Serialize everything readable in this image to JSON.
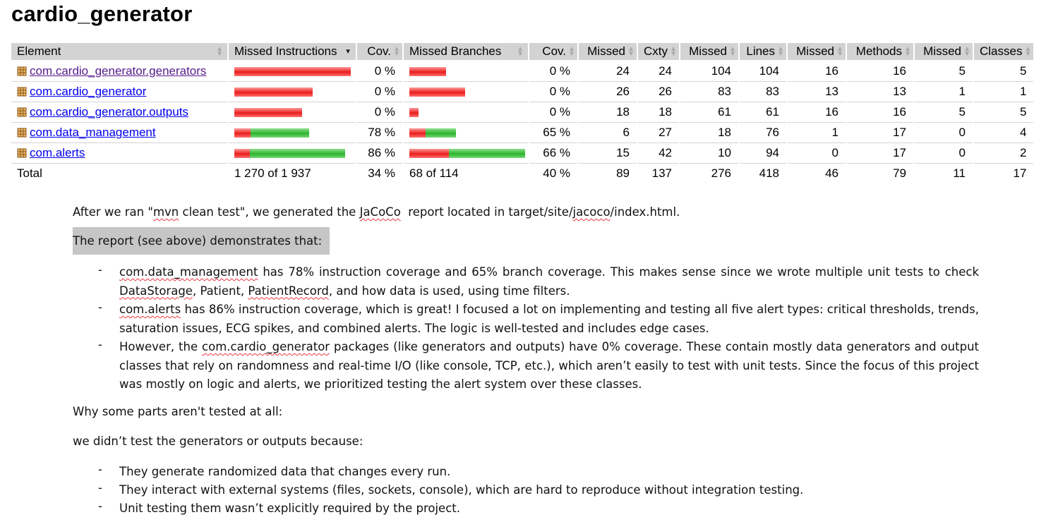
{
  "title": "cardio_generator",
  "table": {
    "headers": [
      "Element",
      "Missed Instructions",
      "Cov.",
      "Missed Branches",
      "Cov.",
      "Missed",
      "Cxty",
      "Missed",
      "Lines",
      "Missed",
      "Methods",
      "Missed",
      "Classes"
    ],
    "rows": [
      {
        "name": "com.cardio_generator.generators",
        "instr_cov_fraction": 0,
        "instr_cov": "0 %",
        "branch_cov_fraction": 0,
        "branch_cov": "0 %",
        "missed_cxty": "24",
        "cxty": "24",
        "missed_lines": "104",
        "lines": "104",
        "missed_methods": "16",
        "methods": "16",
        "missed_classes": "5",
        "classes": "5"
      },
      {
        "name": "com.cardio_generator",
        "instr_cov_fraction": 0,
        "instr_cov": "0 %",
        "branch_cov_fraction": 0,
        "branch_cov": "0 %",
        "missed_cxty": "26",
        "cxty": "26",
        "missed_lines": "83",
        "lines": "83",
        "missed_methods": "13",
        "methods": "13",
        "missed_classes": "1",
        "classes": "1"
      },
      {
        "name": "com.cardio_generator.outputs",
        "instr_cov_fraction": 0,
        "instr_cov": "0 %",
        "branch_cov_fraction": 0,
        "branch_cov": "0 %",
        "missed_cxty": "18",
        "cxty": "18",
        "missed_lines": "61",
        "lines": "61",
        "missed_methods": "16",
        "methods": "16",
        "missed_classes": "5",
        "classes": "5"
      },
      {
        "name": "com.data_management",
        "instr_cov_fraction": 0.78,
        "instr_cov": "78 %",
        "branch_cov_fraction": 0.65,
        "branch_cov": "65 %",
        "missed_cxty": "6",
        "cxty": "27",
        "missed_lines": "18",
        "lines": "76",
        "missed_methods": "1",
        "methods": "17",
        "missed_classes": "0",
        "classes": "4"
      },
      {
        "name": "com.alerts",
        "instr_cov_fraction": 0.86,
        "instr_cov": "86 %",
        "branch_cov_fraction": 0.66,
        "branch_cov": "66 %",
        "missed_cxty": "15",
        "cxty": "42",
        "missed_lines": "10",
        "lines": "94",
        "missed_methods": "0",
        "methods": "17",
        "missed_classes": "0",
        "classes": "2"
      }
    ],
    "total": {
      "label": "Total",
      "instructions": "1 270 of 1 937",
      "instr_cov": "34 %",
      "branches": "68 of 114",
      "branch_cov": "40 %",
      "missed_cxty": "89",
      "cxty": "137",
      "missed_lines": "276",
      "lines": "418",
      "missed_methods": "46",
      "methods": "79",
      "missed_classes": "11",
      "classes": "17"
    }
  },
  "doc": {
    "intro_prefix": "After we ran \"",
    "intro_mvn": "mvn",
    "intro_mid": " clean test\", we generated the ",
    "intro_jacoco": "JaCoCo",
    "intro_mid2": "  report located in target/site/",
    "intro_jacoco2": "jacoco",
    "intro_suffix": "/index.html.",
    "report_heading": "The report (see above) demonstrates that:",
    "b1_pkg": "com.data_management",
    "b1_a": " has 78% instruction coverage and 65% branch coverage. This makes sense since we wrote multiple unit tests to check ",
    "b1_ds": "DataStorage",
    "b1_b": ", Patient, ",
    "b1_pr": "PatientRecord",
    "b1_c": ", and how data is used, using time filters.",
    "b2_pkg": "com.alerts",
    "b2_rest": " has 86% instruction coverage, which is great! I focused a lot on implementing and testing all five alert types: critical thresholds, trends, saturation issues, ECG spikes, and combined alerts. The logic is well-tested and includes edge cases.",
    "b3_a": "However, the ",
    "b3_pkg": "com.cardio_generator",
    "b3_rest": " packages (like generators and outputs) have 0% coverage. These contain mostly data generators and output classes that rely on randomness and real-time I/O (like console, TCP, etc.), which aren’t easily to test with unit tests. Since the focus of this project was mostly on logic and alerts, we prioritized testing the alert system over these classes.",
    "why_heading": "Why some parts aren't tested at all:",
    "because": "we didn’t test the generators or outputs because:",
    "reasons": [
      "They generate randomized data that changes every run.",
      "They interact with external systems (files, sockets, console), which are hard to reproduce without integration testing.",
      "Unit testing them wasn’t explicitly required by the project."
    ],
    "dash": "-"
  }
}
